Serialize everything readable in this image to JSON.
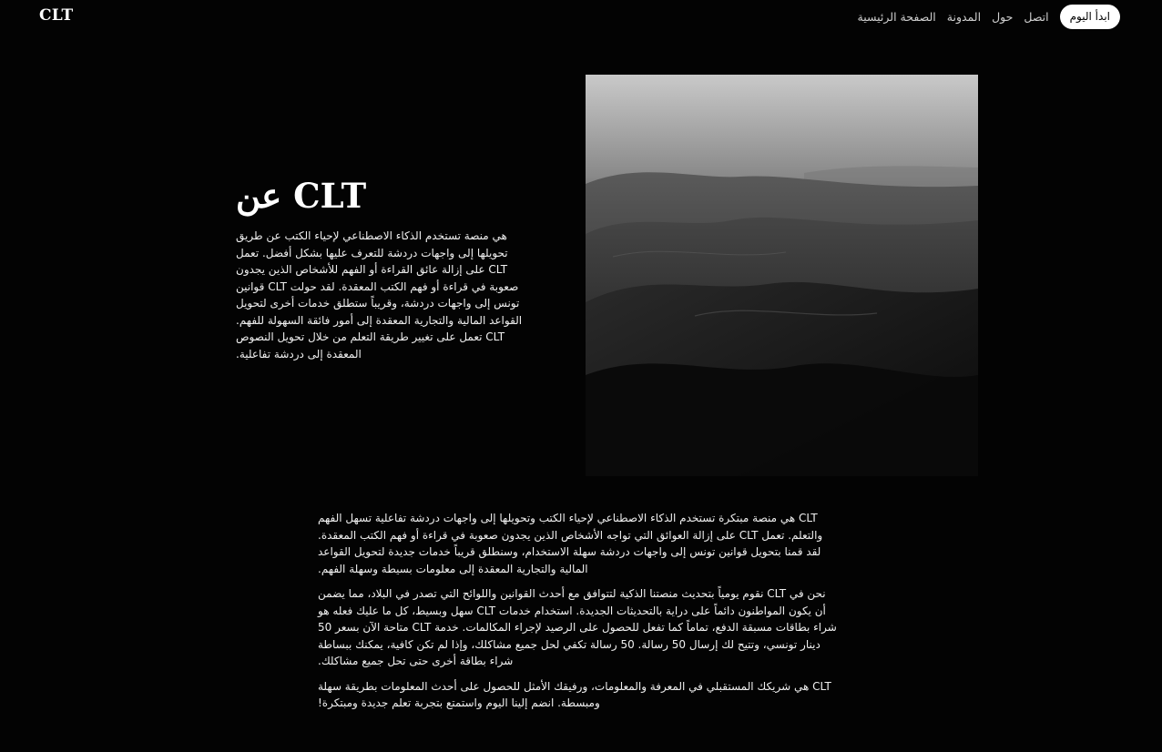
{
  "header": {
    "logo": "CLT",
    "nav": {
      "home": "الصفحة الرئيسية",
      "blog": "المدونة",
      "about": "حول",
      "contact": "اتصل",
      "cta": "ابدأ اليوم"
    }
  },
  "hero": {
    "title": "عن CLT",
    "text": "هي منصة تستخدم الذكاء الاصطناعي لإحياء الكتب عن طريق تحويلها إلى واجهات دردشة للتعرف عليها بشكل أفضل. تعمل CLT على إزالة عائق القراءة أو الفهم للأشخاص الذين يجدون صعوبة في قراءة أو فهم الكتب المعقدة. لقد حولت CLT قوانين تونس إلى واجهات دردشة، وقريباً ستطلق خدمات أخرى لتحويل القواعد المالية والتجارية المعقدة إلى أمور فائقة السهولة للفهم. CLT تعمل على تغيير طريقة التعلم من خلال تحويل النصوص المعقدة إلى دردشة تفاعلية.",
    "image_alt": "desert-dunes-photo"
  },
  "body": {
    "paragraph_1": "CLT هي منصة مبتكرة تستخدم الذكاء الاصطناعي لإحياء الكتب وتحويلها إلى واجهات دردشة تفاعلية تسهل الفهم والتعلم. تعمل CLT على إزالة العوائق التي تواجه الأشخاص الذين يجدون صعوبة في قراءة أو فهم الكتب المعقدة. لقد قمنا بتحويل قوانين تونس إلى واجهات دردشة سهلة الاستخدام، وسنطلق قريباً خدمات جديدة لتحويل القواعد المالية والتجارية المعقدة إلى معلومات بسيطة وسهلة الفهم.",
    "paragraph_2": "نحن في CLT نقوم يومياً بتحديث منصتنا الذكية لتتوافق مع أحدث القوانين واللوائح التي تصدر في البلاد، مما يضمن أن يكون المواطنون دائماً على دراية بالتحديثات الجديدة. استخدام خدمات CLT سهل وبسيط، كل ما عليك فعله هو شراء بطاقات مسبقة الدفع، تماماً كما تفعل للحصول على الرصيد لإجراء المكالمات. خدمة CLT متاحة الآن بسعر 50 دينار تونسي، وتتيح لك إرسال 50 رسالة. 50 رسالة تكفي لحل جميع مشاكلك، وإذا لم تكن كافية، يمكنك ببساطة شراء بطاقة أخرى حتى تحل جميع مشاكلك.",
    "paragraph_3": "CLT هي شريكك المستقبلي في المعرفة والمعلومات، ورفيقك الأمثل للحصول على أحدث المعلومات بطريقة سهلة ومبسطة. انضم إلينا اليوم واستمتع بتجربة تعلم جديدة ومبتكرة!"
  }
}
